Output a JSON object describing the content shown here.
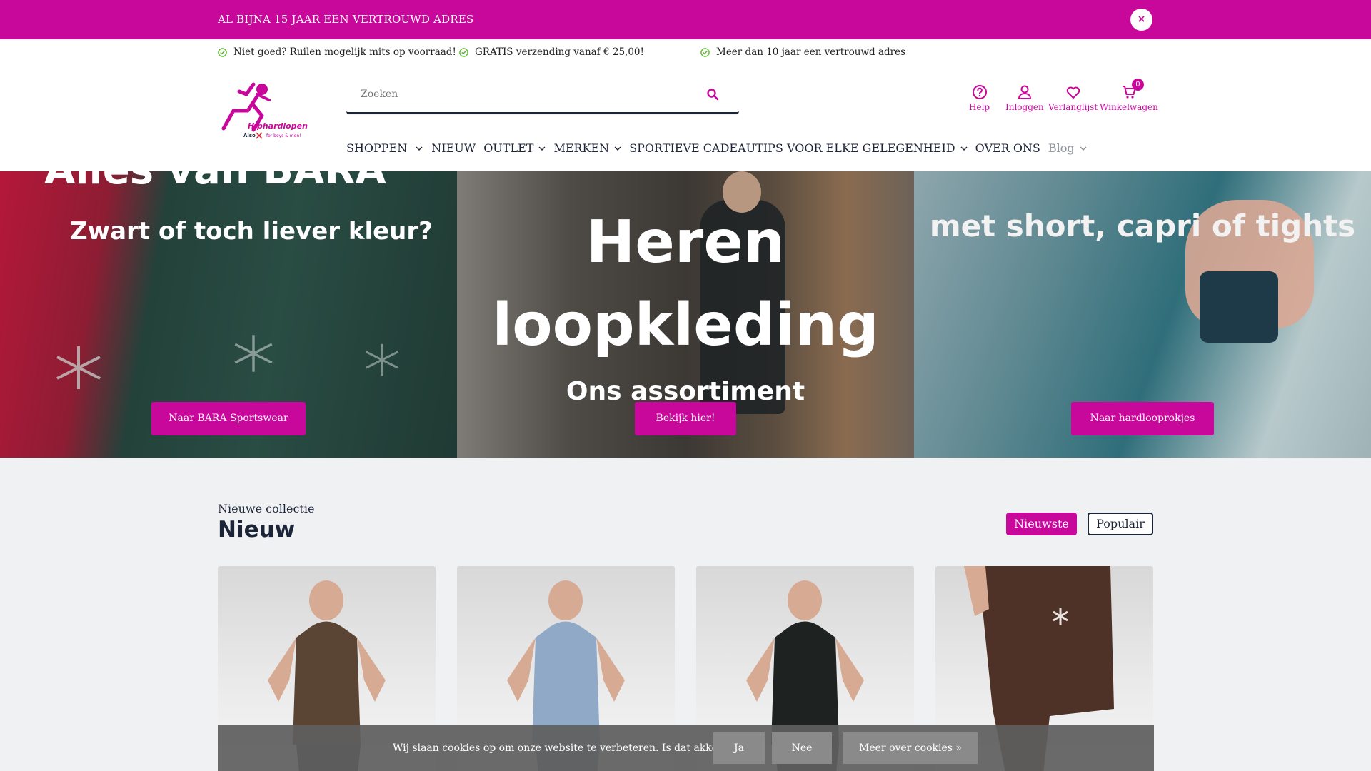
{
  "colors": {
    "accent": "#c8079b",
    "navy": "#1c2438",
    "check": "#5bb82e"
  },
  "topbar": {
    "text": "AL BIJNA 15 JAAR EEN VERTROUWD ADRES",
    "close_icon": "close-icon",
    "close_label": "×"
  },
  "usps": [
    "Niet goed? Ruilen mogelijk mits op voorraad!",
    "GRATIS verzending vanaf € 25,00!",
    "Meer dan 10 jaar een vertrouwd adres"
  ],
  "logo": {
    "name": "Hiphardlopen",
    "tagline": "Also for boys & men!"
  },
  "search": {
    "placeholder": "Zoeken",
    "icon": "search-icon"
  },
  "header_links": [
    {
      "label": "Help",
      "icon": "help-icon"
    },
    {
      "label": "Inloggen",
      "icon": "user-icon"
    },
    {
      "label": "Verlanglijst",
      "icon": "heart-icon"
    },
    {
      "label": "Winkelwagen",
      "icon": "cart-icon",
      "count": "0"
    }
  ],
  "nav": [
    {
      "label": "SHOPPEN",
      "dropdown": true
    },
    {
      "label": "NIEUW",
      "dropdown": false
    },
    {
      "label": "OUTLET",
      "dropdown": true
    },
    {
      "label": "MERKEN",
      "dropdown": true
    },
    {
      "label": "SPORTIEVE CADEAUTIPS VOOR ELKE GELEGENHEID",
      "dropdown": true
    },
    {
      "label": "OVER ONS",
      "dropdown": false
    },
    {
      "label": "Blog",
      "dropdown": true
    }
  ],
  "hero": {
    "panel1": {
      "line1": "Alles van BARA",
      "line2": "Zwart of toch liever kleur?",
      "button": "Naar BARA Sportswear"
    },
    "panel2": {
      "line1": "Heren",
      "line2": "loopkleding",
      "line3": "Ons assortiment",
      "button": "Bekijk hier!"
    },
    "panel3": {
      "line1": "met short, capri of tights",
      "button": "Naar hardlooprokjes"
    }
  },
  "collection": {
    "subtitle": "Nieuwe collectie",
    "title": "Nieuw",
    "tabs": [
      "Nieuwste",
      "Populair"
    ]
  },
  "cookie": {
    "text": "Wij slaan cookies op om onze website te verbeteren. Is dat akkoord?",
    "yes": "Ja",
    "no": "Nee",
    "more": "Meer over cookies »"
  }
}
